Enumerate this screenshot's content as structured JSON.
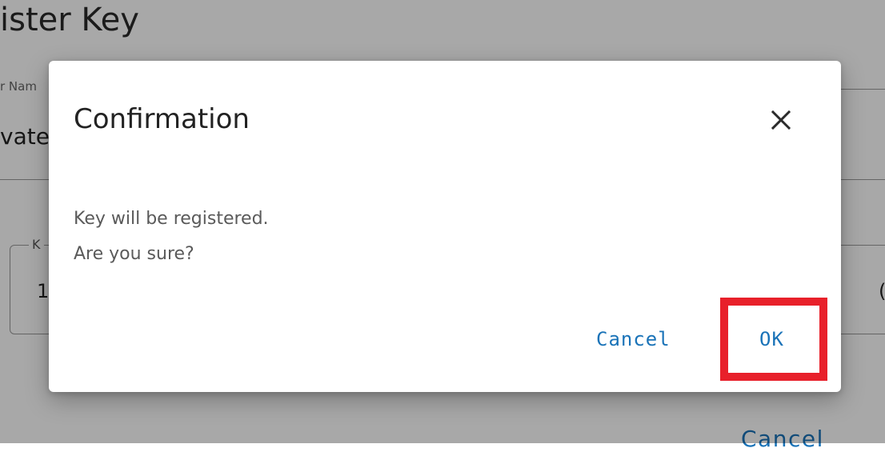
{
  "background": {
    "title": "ister Key",
    "field_label": "r Nam",
    "field_value": "vate",
    "outlined_label": "K",
    "outlined_value": "1",
    "right_glyph": "(",
    "cancel_label": "Cancel"
  },
  "dialog": {
    "title": "Confirmation",
    "close_icon": "close-icon",
    "body_lines": [
      "Key will be registered.",
      "Are you sure?"
    ],
    "cancel_label": "Cancel",
    "ok_label": "OK"
  },
  "colors": {
    "accent": "#1a73b8",
    "highlight": "#e8202a"
  }
}
